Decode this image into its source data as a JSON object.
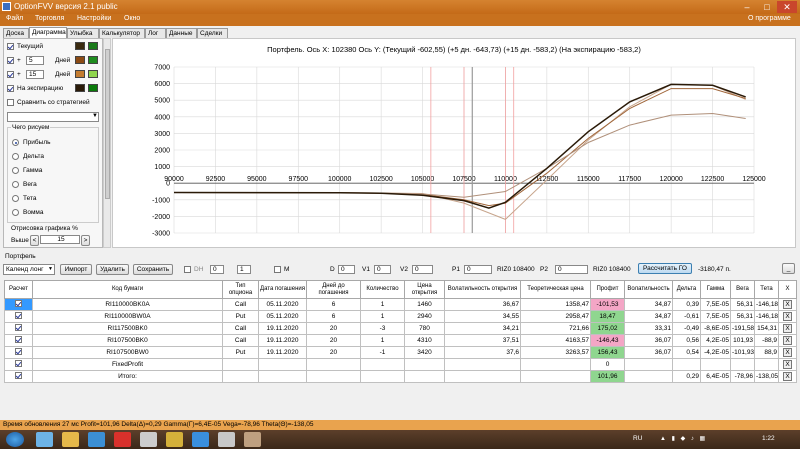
{
  "window": {
    "title": "OptionFVV версия 2.1 public",
    "controls": {
      "min": "–",
      "max": "□",
      "close": "✕"
    }
  },
  "menu": {
    "items": [
      "Файл",
      "Торговля",
      "Настройки",
      "Окно"
    ],
    "about": "О программе"
  },
  "tabs": [
    "Доска",
    "Диаграмма",
    "Улыбка",
    "Калькулятор",
    "Лог",
    "Данные",
    "Сделки"
  ],
  "left": {
    "current_label": "Текущий",
    "plus1": "+",
    "days1_value": "5",
    "days1_label": "Дней",
    "plus2": "+",
    "days2_value": "15",
    "days2_label": "Дней",
    "expiry_label": "На экспирацию",
    "compare_label": "Сравнить со стратегией",
    "compare_value": "",
    "what_label": "Чего рисуем",
    "radios": [
      "Прибыль",
      "Дельта",
      "Гамма",
      "Вега",
      "Тета",
      "Вомма"
    ],
    "render_label": "Отрисовка графика %",
    "above_label": "Выше",
    "above_value": "15"
  },
  "colors": {
    "current": [
      "#3a2a10",
      "#1a7a1a"
    ],
    "days5": [
      "#8b4a14",
      "#1e8c1e"
    ],
    "days15": [
      "#c47c30",
      "#8fd44d"
    ],
    "expiry": [
      "#2a1a08",
      "#0a7a0a"
    ],
    "accent": "#3399ff",
    "profit_neg": "#f4a6c6",
    "profit_pos": "#8fd68f"
  },
  "chart": {
    "title": "Портфель. Ось X: 102380 Ось Y: (Текущий -602,55) (+5 дн. -643,73) (+15 дн. -583,2) (На экспирацию -583,2)"
  },
  "chart_data": {
    "type": "line",
    "xlim": [
      90000,
      125000
    ],
    "ylim": [
      -3000,
      7000
    ],
    "x_ticks": [
      "90000",
      "92500",
      "95000",
      "97500",
      "100000",
      "102500",
      "105000",
      "107500",
      "110000",
      "112500",
      "115000",
      "117500",
      "120000",
      "122500",
      "125000"
    ],
    "y_ticks": [
      "7000",
      "6000",
      "5000",
      "4000",
      "3000",
      "2000",
      "1000",
      "0",
      "-1000",
      "-2000",
      "-3000"
    ],
    "current_x": 108000,
    "vlines": [
      105500,
      107500,
      110000,
      110500
    ],
    "series": [
      {
        "x": [
          90000,
          95000,
          100000,
          102500,
          105000,
          107500,
          110000,
          112500,
          115000,
          117500,
          120000,
          122500,
          124500
        ],
        "y": [
          -560,
          -565,
          -580,
          -590,
          -620,
          -1200,
          -2180,
          200,
          2600,
          4600,
          5950,
          5900,
          5050
        ]
      },
      {
        "x": [
          90000,
          95000,
          100000,
          102500,
          105000,
          107500,
          109000,
          110000,
          112500,
          115000,
          117500,
          120000,
          122500,
          124500
        ],
        "y": [
          -560,
          -565,
          -580,
          -600,
          -680,
          -1000,
          -1350,
          -1200,
          600,
          2700,
          4500,
          5700,
          5700,
          5100
        ]
      },
      {
        "x": [
          90000,
          95000,
          100000,
          102500,
          105000,
          107500,
          110000,
          112500,
          115000,
          117500,
          120000,
          122500,
          124500
        ],
        "y": [
          -560,
          -565,
          -575,
          -590,
          -650,
          -850,
          -500,
          900,
          2450,
          3500,
          4100,
          4200,
          3900
        ]
      },
      {
        "x": [
          90000,
          95000,
          100000,
          102500,
          105000,
          107500,
          109000,
          110000,
          112500,
          115000,
          117500,
          120000,
          122500,
          124500
        ],
        "y": [
          -560,
          -565,
          -580,
          -600,
          -720,
          -1050,
          -1500,
          -1150,
          900,
          3100,
          4900,
          5950,
          5900,
          5200
        ]
      }
    ]
  },
  "portfolio": {
    "group_label": "Портфель",
    "account": "Календ лонг",
    "buttons": {
      "import": "Импорт",
      "delete": "Удалить",
      "save": "Сохранить",
      "calc_go": "Рассчитать ГО",
      "extra": "_"
    },
    "dh_label": "DH",
    "dh_a": "0",
    "dh_b": "1",
    "m_label": "M",
    "d_label": "D",
    "d_value": "0",
    "v1_label": "V1",
    "v1_value": "0",
    "v2_label": "V2",
    "v2_value": "0",
    "p1_label": "P1",
    "p1_value": "0",
    "riz_label1": "RIZ0 108400",
    "p2_label": "P2",
    "p2_value": "0",
    "riz_label2": "RIZ0 108400",
    "go_value": "-3180,47 п."
  },
  "table": {
    "headers": [
      "Расчет",
      "Код бумаги",
      "Тип опциона",
      "Дата погашения",
      "Дней до погашения",
      "Количество",
      "Цена открытия",
      "Волатильность открытия",
      "Теоретическая цена",
      "Профит",
      "Волатильность",
      "Дельта",
      "Гамма",
      "Вега",
      "Тета",
      "X"
    ],
    "rows": [
      {
        "code": "RI110000BK0A",
        "type": "Call",
        "date": "05.11.2020",
        "days": "6",
        "qty": "1",
        "price": "1460",
        "vol": "36,67",
        "theo": "1358,47",
        "profit": "-101,53",
        "volnow": "34,87",
        "delta": "0,39",
        "gamma": "7,5E-05",
        "vega": "56,31",
        "theta": "-146,18",
        "neg": true
      },
      {
        "code": "RI110000BW0A",
        "type": "Put",
        "date": "05.11.2020",
        "days": "6",
        "qty": "1",
        "price": "2940",
        "vol": "34,55",
        "theo": "2958,47",
        "profit": "18,47",
        "volnow": "34,87",
        "delta": "-0,61",
        "gamma": "7,5E-05",
        "vega": "56,31",
        "theta": "-146,18",
        "neg": false
      },
      {
        "code": "RI117500BK0",
        "type": "Call",
        "date": "19.11.2020",
        "days": "20",
        "qty": "-3",
        "price": "780",
        "vol": "34,21",
        "theo": "721,66",
        "profit": "175,02",
        "volnow": "33,31",
        "delta": "-0,49",
        "gamma": "-8,6E-05",
        "vega": "-191,58",
        "theta": "154,31",
        "neg": false
      },
      {
        "code": "RI107500BK0",
        "type": "Call",
        "date": "19.11.2020",
        "days": "20",
        "qty": "1",
        "price": "4310",
        "vol": "37,51",
        "theo": "4163,57",
        "profit": "-146,43",
        "volnow": "36,07",
        "delta": "0,56",
        "gamma": "4,2E-05",
        "vega": "101,93",
        "theta": "-88,9",
        "neg": true
      },
      {
        "code": "RI107500BW0",
        "type": "Put",
        "date": "19.11.2020",
        "days": "20",
        "qty": "-1",
        "price": "3420",
        "vol": "37,6",
        "theo": "3263,57",
        "profit": "156,43",
        "volnow": "36,07",
        "delta": "0,54",
        "gamma": "-4,2E-05",
        "vega": "-101,93",
        "theta": "88,9",
        "neg": false
      },
      {
        "code": "FixedProfit",
        "type": "",
        "date": "",
        "days": "",
        "qty": "",
        "price": "",
        "vol": "",
        "theo": "",
        "profit": "0",
        "volnow": "",
        "delta": "",
        "gamma": "",
        "vega": "",
        "theta": "",
        "neg": null
      },
      {
        "code": "Итого:",
        "type": "",
        "date": "",
        "days": "",
        "qty": "",
        "price": "",
        "vol": "",
        "theo": "",
        "profit": "101,96",
        "volnow": "",
        "delta": "0,29",
        "gamma": "6,4E-05",
        "vega": "-78,96",
        "theta": "-138,05",
        "neg": false
      }
    ],
    "x_label": "X"
  },
  "status": "Время обновления 27 мс   Profit=101,96 Delta(Δ)=0,29 Gamma(Γ)=6,4E-05 Vega=-78,96 Theta(Θ)=-138,05",
  "taskbar": {
    "lang": "RU",
    "time": "1:22"
  }
}
